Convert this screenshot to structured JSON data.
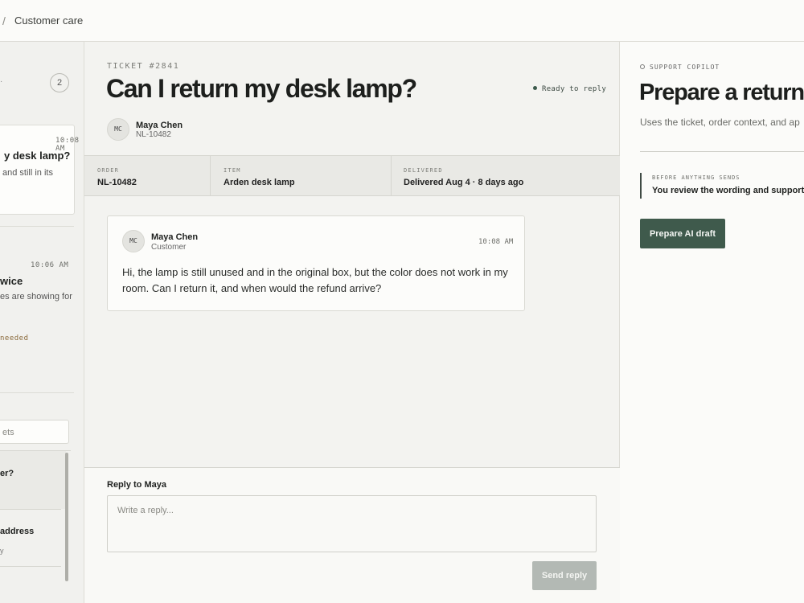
{
  "breadcrumb": {
    "separator": "/",
    "current": "Customer care"
  },
  "queue": {
    "count": "2",
    "items": [
      {
        "time": "10:08 AM",
        "title": "y desk lamp?",
        "snippet": "and still in its"
      },
      {
        "time": "10:06 AM",
        "title": "wice",
        "snippet": "es are showing for",
        "flag": "needed"
      }
    ],
    "search_placeholder": "ets",
    "list": [
      {
        "title": "er?"
      },
      {
        "title": "address",
        "meta": "y"
      }
    ]
  },
  "ticket": {
    "id_label": "TICKET #2841",
    "title": "Can I return my desk lamp?",
    "status": "Ready to reply",
    "customer": {
      "initials": "MC",
      "name": "Maya Chen",
      "id": "NL-10482"
    },
    "meta": [
      {
        "label": "ORDER",
        "value": "NL-10482"
      },
      {
        "label": "ITEM",
        "value": "Arden desk lamp"
      },
      {
        "label": "DELIVERED",
        "value": "Delivered Aug 4 · 8 days ago"
      }
    ]
  },
  "message": {
    "initials": "MC",
    "name": "Maya Chen",
    "role": "Customer",
    "time": "10:08 AM",
    "body": "Hi, the lamp is still unused and in the original box, but the color does not work in my room. Can I return it, and when would the refund arrive?"
  },
  "reply": {
    "label": "Reply to Maya",
    "placeholder": "Write a reply...",
    "send_label": "Send reply"
  },
  "copilot": {
    "tag": "SUPPORT COPILOT",
    "title": "Prepare a return",
    "description": "Uses the ticket, order context, and ap",
    "notice_label": "BEFORE ANYTHING SENDS",
    "notice_text": "You review the wording and support",
    "button_label": "Prepare AI draft"
  },
  "colors": {
    "accent": "#3f5a4c",
    "send_disabled": "#b3b9b4",
    "status_dot": "#3c5a4c",
    "flag": "#8a6a3b"
  }
}
